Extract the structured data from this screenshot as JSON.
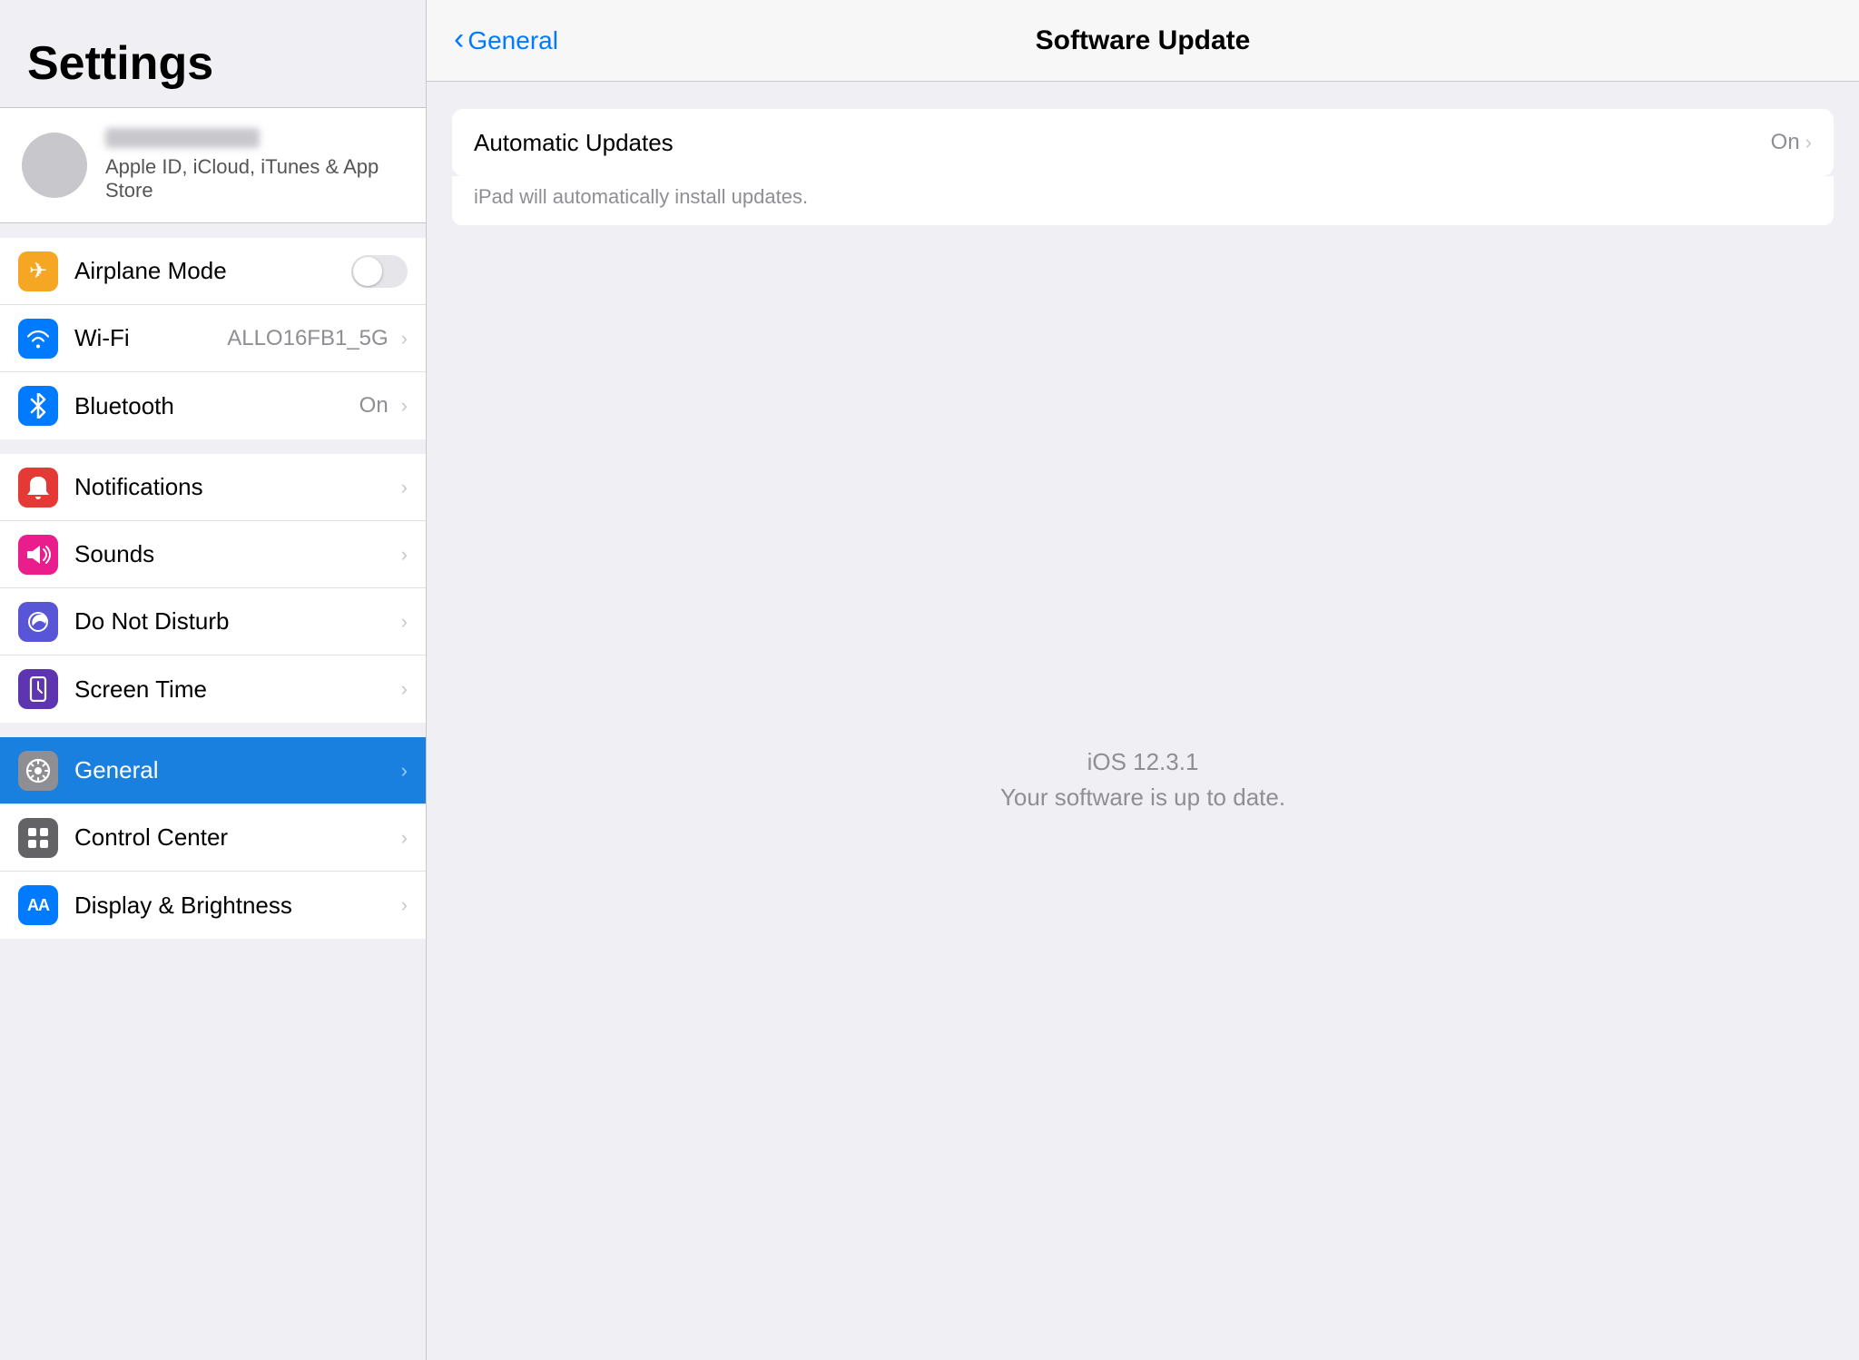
{
  "sidebar": {
    "title": "Settings",
    "account": {
      "subtitle": "Apple ID, iCloud, iTunes & App Store"
    },
    "groups": [
      {
        "id": "connectivity",
        "items": [
          {
            "id": "airplane-mode",
            "label": "Airplane Mode",
            "icon": "✈",
            "iconClass": "icon-orange",
            "valueType": "toggle",
            "toggleOn": false
          },
          {
            "id": "wifi",
            "label": "Wi-Fi",
            "icon": "wifi",
            "iconClass": "icon-blue",
            "valueType": "text",
            "value": "ALLO16FB1_5G"
          },
          {
            "id": "bluetooth",
            "label": "Bluetooth",
            "icon": "bt",
            "iconClass": "icon-blue-bt",
            "valueType": "text",
            "value": "On"
          }
        ]
      },
      {
        "id": "system",
        "items": [
          {
            "id": "notifications",
            "label": "Notifications",
            "icon": "notif",
            "iconClass": "icon-red",
            "valueType": "chevron"
          },
          {
            "id": "sounds",
            "label": "Sounds",
            "icon": "sound",
            "iconClass": "icon-pink",
            "valueType": "chevron"
          },
          {
            "id": "do-not-disturb",
            "label": "Do Not Disturb",
            "icon": "moon",
            "iconClass": "icon-purple",
            "valueType": "chevron"
          },
          {
            "id": "screen-time",
            "label": "Screen Time",
            "icon": "hourglass",
            "iconClass": "icon-purple2",
            "valueType": "chevron"
          }
        ]
      },
      {
        "id": "general-group",
        "items": [
          {
            "id": "general",
            "label": "General",
            "icon": "gear",
            "iconClass": "icon-gray",
            "valueType": "chevron",
            "active": true
          },
          {
            "id": "control-center",
            "label": "Control Center",
            "icon": "sliders",
            "iconClass": "icon-gray2",
            "valueType": "chevron"
          },
          {
            "id": "display-brightness",
            "label": "Display & Brightness",
            "icon": "AA",
            "iconClass": "icon-blue",
            "valueType": "chevron"
          }
        ]
      }
    ]
  },
  "detail": {
    "backLabel": "General",
    "title": "Software Update",
    "automaticUpdates": {
      "label": "Automatic Updates",
      "value": "On",
      "subtitle": "iPad will automatically install updates."
    },
    "iosVersion": "iOS 12.3.1",
    "upToDateText": "Your software is up to date."
  }
}
